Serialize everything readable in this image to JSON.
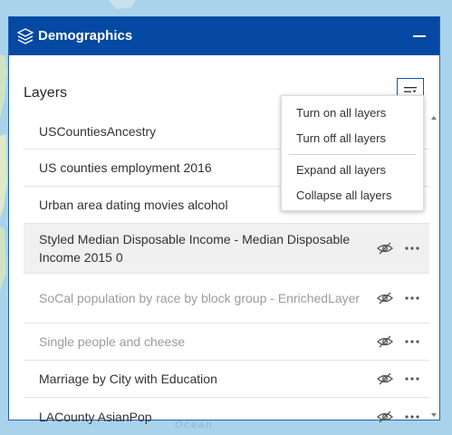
{
  "map": {
    "ocean_label": "Ocean"
  },
  "panel": {
    "title": "Demographics",
    "heading": "Layers",
    "collapse_icon": "minimize-icon",
    "options_icon": "layer-list-options-icon"
  },
  "layers": [
    {
      "label": "USCountiesAncestry",
      "visible": true,
      "show_tools": false
    },
    {
      "label": "US counties employment 2016",
      "visible": true,
      "show_tools": false
    },
    {
      "label": "Urban area dating movies alcohol",
      "visible": true,
      "show_tools": false
    },
    {
      "label": "Styled Median Disposable Income - Median Disposable Income 2015 0",
      "visible": true,
      "show_tools": true,
      "highlighted": true
    },
    {
      "label": "SoCal population by race by block group - EnrichedLayer",
      "visible": false,
      "show_tools": true
    },
    {
      "label": "Single people and cheese",
      "visible": false,
      "show_tools": true
    },
    {
      "label": "Marriage by City with Education",
      "visible": true,
      "show_tools": true
    },
    {
      "label": "LACounty AsianPop",
      "visible": true,
      "show_tools": true
    }
  ],
  "menu": {
    "items": [
      "Turn on all layers",
      "Turn off all layers",
      "Expand all layers",
      "Collapse all layers"
    ]
  },
  "colors": {
    "header": "#0649a3",
    "accent": "#0a56b8",
    "map_water": "#a9d3ea"
  }
}
